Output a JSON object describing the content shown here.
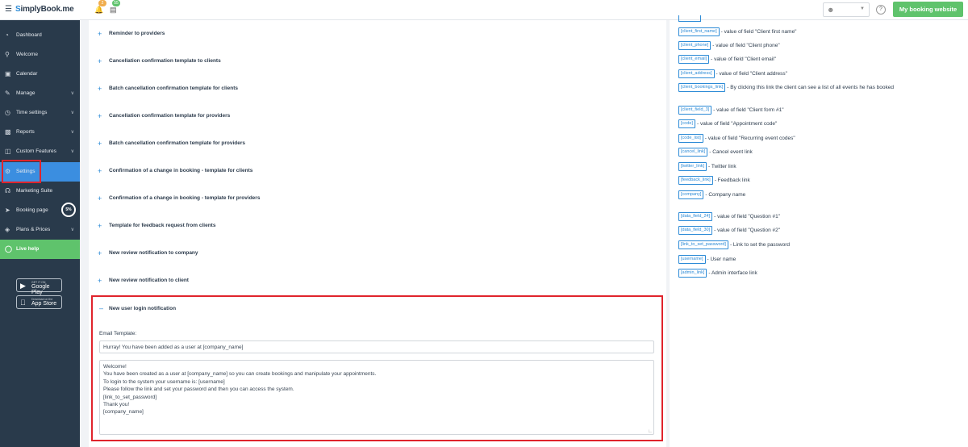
{
  "topbar": {
    "logo_prefix": "S",
    "logo_rest": "implyBook.me",
    "bell_badge": "2",
    "tasks_badge": "55",
    "booking_button": "My booking website",
    "help_glyph": "?"
  },
  "sidebar": {
    "items": [
      {
        "label": "Dashboard",
        "icon": "dashboard-icon"
      },
      {
        "label": "Welcome",
        "icon": "lightbulb-icon"
      },
      {
        "label": "Calendar",
        "icon": "calendar-icon"
      },
      {
        "label": "Manage",
        "icon": "edit-icon"
      },
      {
        "label": "Time settings",
        "icon": "clock-icon"
      },
      {
        "label": "Reports",
        "icon": "chart-icon"
      },
      {
        "label": "Custom Features",
        "icon": "puzzle-icon"
      },
      {
        "label": "Settings",
        "icon": "gear-icon"
      },
      {
        "label": "Marketing Suite",
        "icon": "megaphone-icon"
      },
      {
        "label": "Booking page",
        "icon": "rocket-icon"
      },
      {
        "label": "Plans & Prices",
        "icon": "plans-icon"
      },
      {
        "label": "Live help",
        "icon": "chat-icon"
      }
    ],
    "booking_page_progress": "5%",
    "google_play": {
      "small": "GET IT ON",
      "big": "Google Play"
    },
    "app_store": {
      "small": "Download on the",
      "big": "App Store"
    }
  },
  "accordion": {
    "items": [
      "Reminder to providers",
      "Cancellation confirmation template to clients",
      "Batch cancellation confirmation template for clients",
      "Cancellation confirmation template for providers",
      "Batch cancellation confirmation template for providers",
      "Confirmation of a change in booking - template for clients",
      "Confirmation of a change in booking - template for providers",
      "Template for feedback request from clients",
      "New review notification to company",
      "New review notification to client"
    ],
    "expanded": {
      "title": "New user login notification",
      "email_label": "Email Template:",
      "subject_value": "Hurray! You have been added as a user at [company_name]",
      "body_lines": [
        "Welcome!",
        "You have been created as a user at [company_name] so you can create bookings and manipulate your appointments.",
        "To login to the system your username is: [username]",
        "Please follow the link and set your password and then you can access the system.",
        "[link_to_set_password]",
        "Thank you!",
        "[company_name]"
      ]
    }
  },
  "variables": [
    {
      "code": "[client_first_name]",
      "desc": "- value of field \"Client first name\""
    },
    {
      "code": "[client_phone]",
      "desc": "- value of field \"Client phone\""
    },
    {
      "code": "[client_email]",
      "desc": "- value of field \"Client email\""
    },
    {
      "code": "[client_address]",
      "desc": "- value of field \"Client address\""
    },
    {
      "code": "[client_bookings_link]",
      "desc": "- By clicking this link the client can see a list of all events he has booked"
    },
    {
      "code": "[client_field_3]",
      "desc": "- value of field \"Client form #1\""
    },
    {
      "code": "[code]",
      "desc": "- value of field \"Appointment code\""
    },
    {
      "code": "[code_list]",
      "desc": "- value of field \"Recurring event codes\""
    },
    {
      "code": "[cancel_link]",
      "desc": "- Cancel event link"
    },
    {
      "code": "[twitter_link]",
      "desc": "- Twitter link"
    },
    {
      "code": "[feedback_link]",
      "desc": "- Feedback link"
    },
    {
      "code": "[company]",
      "desc": "- Company name"
    },
    {
      "code": "[data_field_24]",
      "desc": "- value of field \"Question #1\""
    },
    {
      "code": "[data_field_30]",
      "desc": "- value of field \"Question #2\""
    },
    {
      "code": "[link_to_set_password]",
      "desc": "- Link to set the password"
    },
    {
      "code": "[username]",
      "desc": "- User name"
    },
    {
      "code": "[admin_link]",
      "desc": "- Admin interface link"
    }
  ],
  "colors": {
    "sidebar": "#293a4b",
    "active": "#3b8ee0",
    "green": "#5fc36c",
    "highlight": "#e0242c",
    "link": "#2b8ad6"
  }
}
